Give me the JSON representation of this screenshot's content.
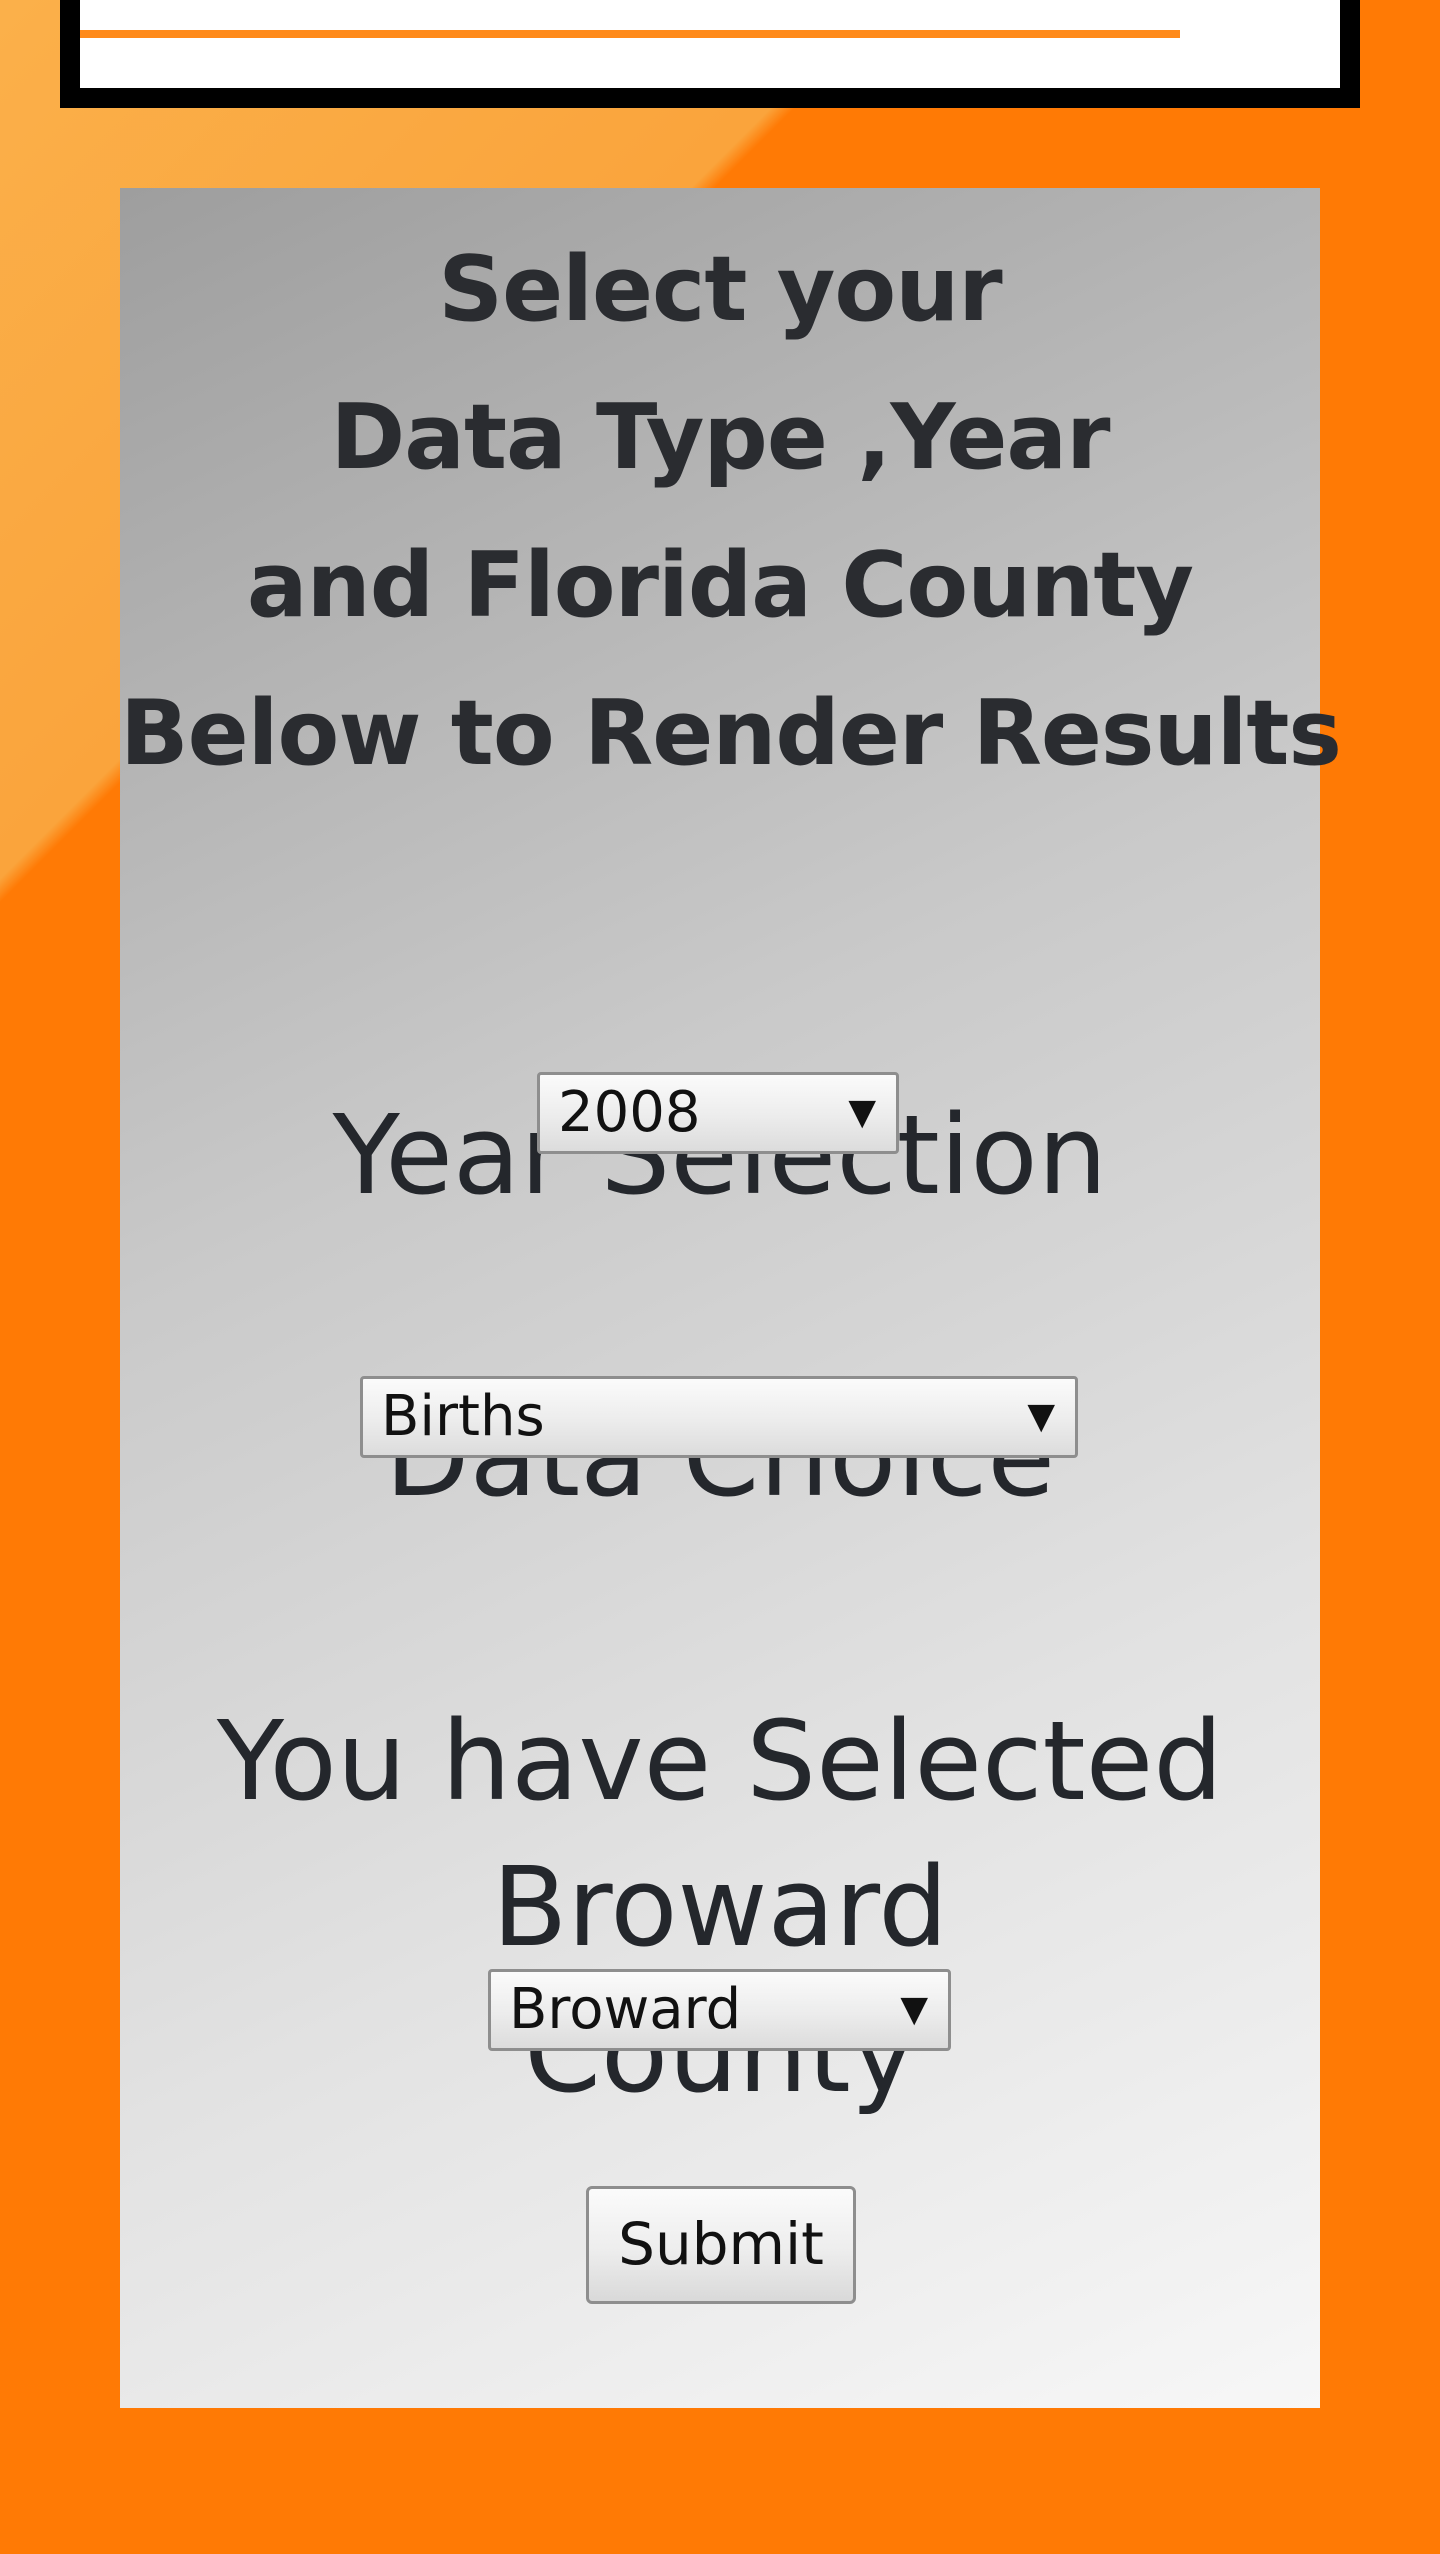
{
  "intro": {
    "lines": [
      "Select your",
      "Data Type ,Year",
      "and Florida County",
      "Below to Render Results"
    ]
  },
  "year": {
    "label": "Year Selection",
    "selected": "2008"
  },
  "data_choice": {
    "label": "Data Choice",
    "selected": "Births"
  },
  "county": {
    "selected_message_line1": "You have Selected",
    "selected_message_line2": "Broward",
    "selected_message_line3": "County",
    "selected": "Broward"
  },
  "submit_label": "Submit",
  "icons": {
    "dropdown_arrow": "▼"
  },
  "colors": {
    "background_orange": "#ff7a05",
    "panel_gray": "#c9c9c9",
    "text_dark": "#24272c"
  }
}
